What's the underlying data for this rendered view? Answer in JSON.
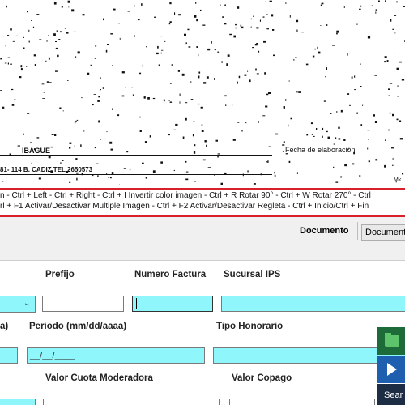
{
  "document_scan": {
    "city": "IBAGUE",
    "address": "81- 114 B. CADIZ TEL 2650573",
    "fecha_label": "Fecha de elaboración",
    "corner_text": "Mk"
  },
  "shortcuts": {
    "line1": "n - Ctrl + Left - Ctrl + Right     - Ctrl + I Invertir color imagen - Ctrl + R Rotar 90° - Ctrl + W Rotar 270°      - Ctrl",
    "line2": "rl + F1 Activar/Desactivar Multiple Imagen - Ctrl + F2 Activar/Desactivar Regleta     - Ctrl + Inicio/Ctrl + Fin"
  },
  "toolbar": {
    "documento_label": "Documento",
    "documento_button": "Documento"
  },
  "form": {
    "prefijo_label": "Prefijo",
    "factura_label": "Numero Factura",
    "sucursal_label": "Sucursal IPS",
    "a_label": "a)",
    "periodo_label": "Periodo (mm/dd/aaaa)",
    "periodo_value": "__/__/____",
    "tipo_label": "Tipo Honorario",
    "cuota_label": "Valor Cuota Moderadora",
    "copago_label": "Valor Copago"
  },
  "side_panel": {
    "search_label": "Sear"
  },
  "colors": {
    "highlight_field": "#8ff6fb",
    "shortcut_border": "#d8202a",
    "toolbar_bg": "#f0f0f0"
  }
}
